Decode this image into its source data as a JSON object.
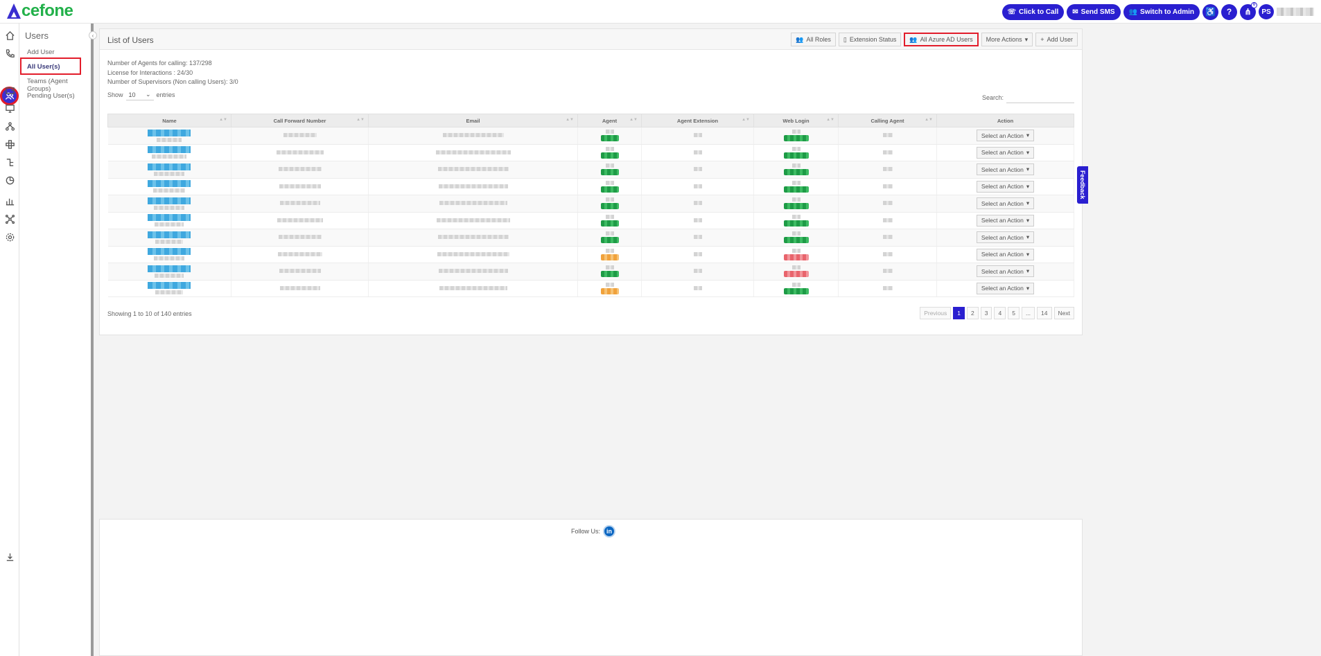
{
  "brand": {
    "logo_text": "cefone"
  },
  "topbar": {
    "click_to_call": "Click to Call",
    "send_sms": "Send SMS",
    "switch_admin": "Switch to Admin",
    "help": "?",
    "avatar_initials": "PS",
    "notification_badge": "0"
  },
  "subnav": {
    "title": "Users",
    "items": [
      {
        "label": "Add User"
      },
      {
        "label": "All User(s)"
      },
      {
        "label": "Teams (Agent Groups)"
      },
      {
        "label": "Pending User(s)"
      }
    ]
  },
  "panel": {
    "title": "List of Users",
    "buttons": {
      "all_roles": "All Roles",
      "extension_status": "Extension Status",
      "all_azure": "All Azure AD Users",
      "more_actions": "More Actions",
      "add_user": "Add User"
    },
    "info": {
      "agents_calling": "Number of Agents for calling: 137/298",
      "license": "License for Interactions : 24/30",
      "supervisors": "Number of Supervisors (Non calling Users): 3/0"
    },
    "show_label": "Show",
    "show_value": "10",
    "entries_label": "entries",
    "search_label": "Search:"
  },
  "table": {
    "columns": [
      "Name",
      "Call Forward Number",
      "Email",
      "Agent",
      "Agent Extension",
      "Web Login",
      "Calling Agent",
      "Action"
    ],
    "rows": [
      {
        "agent": "g",
        "web": "g"
      },
      {
        "agent": "g",
        "web": "g"
      },
      {
        "agent": "g",
        "web": "g"
      },
      {
        "agent": "g",
        "web": "g"
      },
      {
        "agent": "g",
        "web": "g"
      },
      {
        "agent": "g",
        "web": "g"
      },
      {
        "agent": "g",
        "web": "g"
      },
      {
        "agent": "o",
        "web": "r"
      },
      {
        "agent": "g",
        "web": "r"
      },
      {
        "agent": "o",
        "web": "g"
      }
    ],
    "action_label": "Select an Action",
    "status_colors": {
      "g": "#1e9b46",
      "o": "#f0a23c",
      "r": "#e8646c"
    }
  },
  "footer_info": {
    "showing": "Showing 1 to 10 of 140 entries",
    "pages": [
      "Previous",
      "1",
      "2",
      "3",
      "4",
      "5",
      "...",
      "14",
      "Next"
    ]
  },
  "footer": {
    "follow_us": "Follow Us:",
    "linkedin": "in"
  },
  "feedback": "Feedback"
}
